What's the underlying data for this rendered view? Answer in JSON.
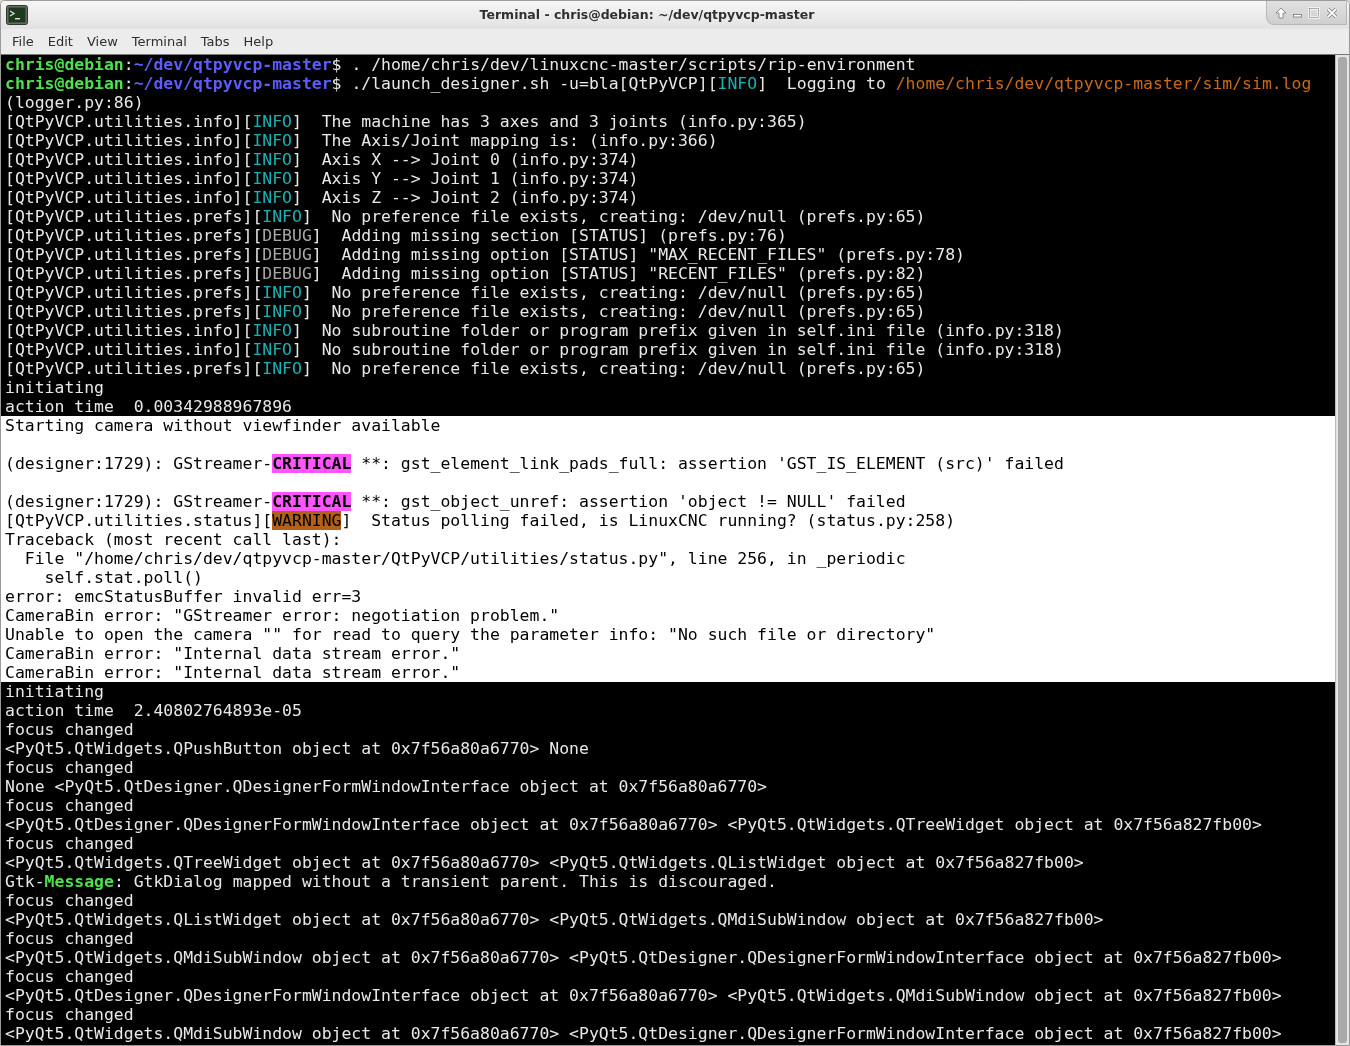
{
  "window": {
    "title": "Terminal - chris@debian: ~/dev/qtpyvcp-master"
  },
  "menu": [
    "File",
    "Edit",
    "View",
    "Terminal",
    "Tabs",
    "Help"
  ],
  "terminal": {
    "lines": [
      {
        "kind": "dark",
        "segments": [
          {
            "kind": "user",
            "text": "chris@debian"
          },
          {
            "kind": "plain",
            "text": ":"
          },
          {
            "kind": "path",
            "text": "~/dev/qtpyvcp-master"
          },
          {
            "kind": "plain",
            "text": "$ . /home/chris/dev/linuxcnc-master/scripts/rip-environment"
          }
        ]
      },
      {
        "kind": "dark",
        "segments": [
          {
            "kind": "user",
            "text": "chris@debian"
          },
          {
            "kind": "plain",
            "text": ":"
          },
          {
            "kind": "path",
            "text": "~/dev/qtpyvcp-master"
          },
          {
            "kind": "plain",
            "text": "$ ./launch_designer.sh -u=bla[QtPyVCP]["
          },
          {
            "kind": "info",
            "text": "INFO"
          },
          {
            "kind": "plain",
            "text": "]  Logging to "
          },
          {
            "kind": "link",
            "text": "/home/chris/dev/qtpyvcp-master/sim/sim.log"
          }
        ]
      },
      {
        "kind": "dark",
        "segments": [
          {
            "kind": "plain",
            "text": "(logger.py:86)"
          }
        ]
      },
      {
        "kind": "dark",
        "segments": [
          {
            "kind": "plain",
            "text": "[QtPyVCP.utilities.info]["
          },
          {
            "kind": "info",
            "text": "INFO"
          },
          {
            "kind": "plain",
            "text": "]  The machine has 3 axes and 3 joints (info.py:365)"
          }
        ]
      },
      {
        "kind": "dark",
        "segments": [
          {
            "kind": "plain",
            "text": "[QtPyVCP.utilities.info]["
          },
          {
            "kind": "info",
            "text": "INFO"
          },
          {
            "kind": "plain",
            "text": "]  The Axis/Joint mapping is: (info.py:366)"
          }
        ]
      },
      {
        "kind": "dark",
        "segments": [
          {
            "kind": "plain",
            "text": "[QtPyVCP.utilities.info]["
          },
          {
            "kind": "info",
            "text": "INFO"
          },
          {
            "kind": "plain",
            "text": "]  Axis X --> Joint 0 (info.py:374)"
          }
        ]
      },
      {
        "kind": "dark",
        "segments": [
          {
            "kind": "plain",
            "text": "[QtPyVCP.utilities.info]["
          },
          {
            "kind": "info",
            "text": "INFO"
          },
          {
            "kind": "plain",
            "text": "]  Axis Y --> Joint 1 (info.py:374)"
          }
        ]
      },
      {
        "kind": "dark",
        "segments": [
          {
            "kind": "plain",
            "text": "[QtPyVCP.utilities.info]["
          },
          {
            "kind": "info",
            "text": "INFO"
          },
          {
            "kind": "plain",
            "text": "]  Axis Z --> Joint 2 (info.py:374)"
          }
        ]
      },
      {
        "kind": "dark",
        "segments": [
          {
            "kind": "plain",
            "text": "[QtPyVCP.utilities.prefs]["
          },
          {
            "kind": "info",
            "text": "INFO"
          },
          {
            "kind": "plain",
            "text": "]  No preference file exists, creating: /dev/null (prefs.py:65)"
          }
        ]
      },
      {
        "kind": "dark",
        "segments": [
          {
            "kind": "plain",
            "text": "[QtPyVCP.utilities.prefs]["
          },
          {
            "kind": "debug",
            "text": "DEBUG"
          },
          {
            "kind": "plain",
            "text": "]  Adding missing section [STATUS] (prefs.py:76)"
          }
        ]
      },
      {
        "kind": "dark",
        "segments": [
          {
            "kind": "plain",
            "text": "[QtPyVCP.utilities.prefs]["
          },
          {
            "kind": "debug",
            "text": "DEBUG"
          },
          {
            "kind": "plain",
            "text": "]  Adding missing option [STATUS] \"MAX_RECENT_FILES\" (prefs.py:78)"
          }
        ]
      },
      {
        "kind": "dark",
        "segments": [
          {
            "kind": "plain",
            "text": "[QtPyVCP.utilities.prefs]["
          },
          {
            "kind": "debug",
            "text": "DEBUG"
          },
          {
            "kind": "plain",
            "text": "]  Adding missing option [STATUS] \"RECENT_FILES\" (prefs.py:82)"
          }
        ]
      },
      {
        "kind": "dark",
        "segments": [
          {
            "kind": "plain",
            "text": "[QtPyVCP.utilities.prefs]["
          },
          {
            "kind": "info",
            "text": "INFO"
          },
          {
            "kind": "plain",
            "text": "]  No preference file exists, creating: /dev/null (prefs.py:65)"
          }
        ]
      },
      {
        "kind": "dark",
        "segments": [
          {
            "kind": "plain",
            "text": "[QtPyVCP.utilities.prefs]["
          },
          {
            "kind": "info",
            "text": "INFO"
          },
          {
            "kind": "plain",
            "text": "]  No preference file exists, creating: /dev/null (prefs.py:65)"
          }
        ]
      },
      {
        "kind": "dark",
        "segments": [
          {
            "kind": "plain",
            "text": "[QtPyVCP.utilities.info]["
          },
          {
            "kind": "info",
            "text": "INFO"
          },
          {
            "kind": "plain",
            "text": "]  No subroutine folder or program prefix given in self.ini file (info.py:318)"
          }
        ]
      },
      {
        "kind": "dark",
        "segments": [
          {
            "kind": "plain",
            "text": "[QtPyVCP.utilities.info]["
          },
          {
            "kind": "info",
            "text": "INFO"
          },
          {
            "kind": "plain",
            "text": "]  No subroutine folder or program prefix given in self.ini file (info.py:318)"
          }
        ]
      },
      {
        "kind": "dark",
        "segments": [
          {
            "kind": "plain",
            "text": "[QtPyVCP.utilities.prefs]["
          },
          {
            "kind": "info",
            "text": "INFO"
          },
          {
            "kind": "plain",
            "text": "]  No preference file exists, creating: /dev/null (prefs.py:65)"
          }
        ]
      },
      {
        "kind": "dark",
        "segments": [
          {
            "kind": "plain",
            "text": "initiating"
          }
        ]
      },
      {
        "kind": "dark",
        "segments": [
          {
            "kind": "plain",
            "text": "action time  0.00342988967896"
          }
        ]
      },
      {
        "kind": "light",
        "segments": [
          {
            "kind": "plain",
            "text": "Starting camera without viewfinder available"
          }
        ]
      },
      {
        "kind": "light"
      },
      {
        "kind": "light",
        "segments": [
          {
            "kind": "plain",
            "text": "(designer:1729): GStreamer-"
          },
          {
            "kind": "critical",
            "text": "CRITICAL"
          },
          {
            "kind": "plain",
            "text": " **: gst_element_link_pads_full: assertion 'GST_IS_ELEMENT (src)' failed"
          }
        ]
      },
      {
        "kind": "light"
      },
      {
        "kind": "light",
        "segments": [
          {
            "kind": "plain",
            "text": "(designer:1729): GStreamer-"
          },
          {
            "kind": "critical",
            "text": "CRITICAL"
          },
          {
            "kind": "plain",
            "text": " **: gst_object_unref: assertion 'object != NULL' failed"
          }
        ]
      },
      {
        "kind": "light",
        "segments": [
          {
            "kind": "plain",
            "text": "[QtPyVCP.utilities.status]["
          },
          {
            "kind": "warning",
            "text": "WARNING"
          },
          {
            "kind": "plain",
            "text": "]  Status polling failed, is LinuxCNC running? (status.py:258)"
          }
        ]
      },
      {
        "kind": "light",
        "segments": [
          {
            "kind": "plain",
            "text": "Traceback (most recent call last):"
          }
        ]
      },
      {
        "kind": "light",
        "segments": [
          {
            "kind": "plain",
            "text": "  File \"/home/chris/dev/qtpyvcp-master/QtPyVCP/utilities/status.py\", line 256, in _periodic"
          }
        ]
      },
      {
        "kind": "light",
        "segments": [
          {
            "kind": "plain",
            "text": "    self.stat.poll()"
          }
        ]
      },
      {
        "kind": "light",
        "segments": [
          {
            "kind": "plain",
            "text": "error: emcStatusBuffer invalid err=3"
          }
        ]
      },
      {
        "kind": "light",
        "segments": [
          {
            "kind": "plain",
            "text": "CameraBin error: \"GStreamer error: negotiation problem.\""
          }
        ]
      },
      {
        "kind": "light",
        "segments": [
          {
            "kind": "plain",
            "text": "Unable to open the camera \"\" for read to query the parameter info: \"No such file or directory\""
          }
        ]
      },
      {
        "kind": "light",
        "segments": [
          {
            "kind": "plain",
            "text": "CameraBin error: \"Internal data stream error.\""
          }
        ]
      },
      {
        "kind": "light",
        "segments": [
          {
            "kind": "plain",
            "text": "CameraBin error: \"Internal data stream error.\""
          }
        ]
      },
      {
        "kind": "dark",
        "segments": [
          {
            "kind": "plain",
            "text": "initiating"
          }
        ]
      },
      {
        "kind": "dark",
        "segments": [
          {
            "kind": "plain",
            "text": "action time  2.40802764893e-05"
          }
        ]
      },
      {
        "kind": "dark",
        "segments": [
          {
            "kind": "plain",
            "text": "focus changed"
          }
        ]
      },
      {
        "kind": "dark",
        "segments": [
          {
            "kind": "plain",
            "text": "<PyQt5.QtWidgets.QPushButton object at 0x7f56a80a6770> None"
          }
        ]
      },
      {
        "kind": "dark",
        "segments": [
          {
            "kind": "plain",
            "text": "focus changed"
          }
        ]
      },
      {
        "kind": "dark",
        "segments": [
          {
            "kind": "plain",
            "text": "None <PyQt5.QtDesigner.QDesignerFormWindowInterface object at 0x7f56a80a6770>"
          }
        ]
      },
      {
        "kind": "dark",
        "segments": [
          {
            "kind": "plain",
            "text": "focus changed"
          }
        ]
      },
      {
        "kind": "dark",
        "segments": [
          {
            "kind": "plain",
            "text": "<PyQt5.QtDesigner.QDesignerFormWindowInterface object at 0x7f56a80a6770> <PyQt5.QtWidgets.QTreeWidget object at 0x7f56a827fb00>"
          }
        ]
      },
      {
        "kind": "dark",
        "segments": [
          {
            "kind": "plain",
            "text": "focus changed"
          }
        ]
      },
      {
        "kind": "dark",
        "segments": [
          {
            "kind": "plain",
            "text": "<PyQt5.QtWidgets.QTreeWidget object at 0x7f56a80a6770> <PyQt5.QtWidgets.QListWidget object at 0x7f56a827fb00>"
          }
        ]
      },
      {
        "kind": "dark",
        "segments": [
          {
            "kind": "plain",
            "text": "Gtk-"
          },
          {
            "kind": "message",
            "text": "Message"
          },
          {
            "kind": "plain",
            "text": ": GtkDialog mapped without a transient parent. This is discouraged."
          }
        ]
      },
      {
        "kind": "dark",
        "segments": [
          {
            "kind": "plain",
            "text": "focus changed"
          }
        ]
      },
      {
        "kind": "dark",
        "segments": [
          {
            "kind": "plain",
            "text": "<PyQt5.QtWidgets.QListWidget object at 0x7f56a80a6770> <PyQt5.QtWidgets.QMdiSubWindow object at 0x7f56a827fb00>"
          }
        ]
      },
      {
        "kind": "dark",
        "segments": [
          {
            "kind": "plain",
            "text": "focus changed"
          }
        ]
      },
      {
        "kind": "dark",
        "segments": [
          {
            "kind": "plain",
            "text": "<PyQt5.QtWidgets.QMdiSubWindow object at 0x7f56a80a6770> <PyQt5.QtDesigner.QDesignerFormWindowInterface object at 0x7f56a827fb00>"
          }
        ]
      },
      {
        "kind": "dark",
        "segments": [
          {
            "kind": "plain",
            "text": "focus changed"
          }
        ]
      },
      {
        "kind": "dark",
        "segments": [
          {
            "kind": "plain",
            "text": "<PyQt5.QtDesigner.QDesignerFormWindowInterface object at 0x7f56a80a6770> <PyQt5.QtWidgets.QMdiSubWindow object at 0x7f56a827fb00>"
          }
        ]
      },
      {
        "kind": "dark",
        "segments": [
          {
            "kind": "plain",
            "text": "focus changed"
          }
        ]
      },
      {
        "kind": "dark",
        "segments": [
          {
            "kind": "plain",
            "text": "<PyQt5.QtWidgets.QMdiSubWindow object at 0x7f56a80a6770> <PyQt5.QtDesigner.QDesignerFormWindowInterface object at 0x7f56a827fb00>"
          }
        ]
      }
    ]
  }
}
